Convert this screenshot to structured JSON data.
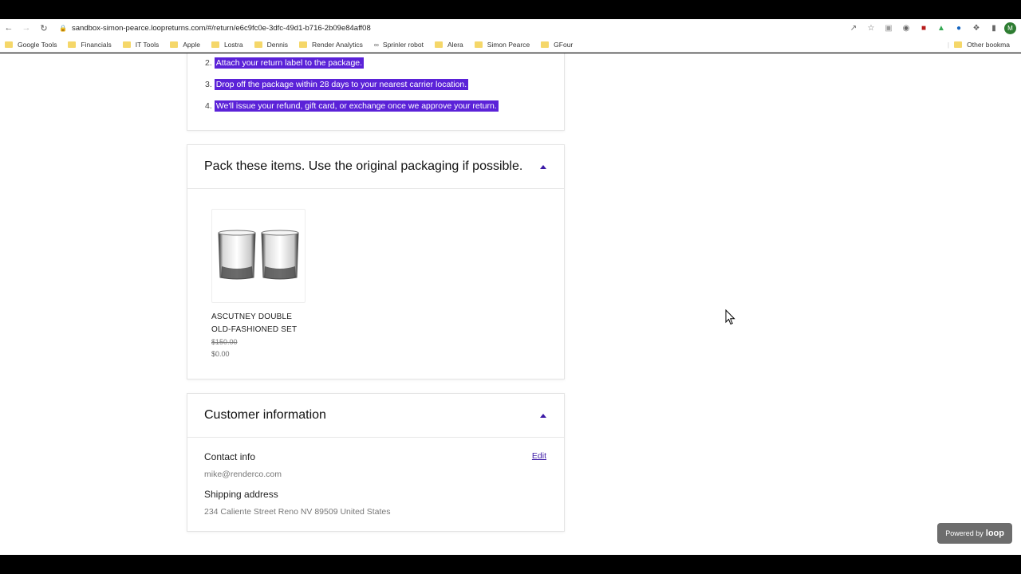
{
  "browser": {
    "url": "sandbox-simon-pearce.loopreturns.com/#/return/e6c9fc0e-3dfc-49d1-b716-2b09e84aff08",
    "avatar_letter": "M",
    "bookmarks": [
      "Google Tools",
      "Financials",
      "IT Tools",
      "Apple",
      "Lostra",
      "Dennis",
      "Render Analytics",
      "Sprinler robot",
      "Alera",
      "Simon Pearce",
      "GFour"
    ],
    "other_bookmarks": "Other bookma"
  },
  "steps": [
    {
      "num": "2.",
      "text": "Attach your return label to the package."
    },
    {
      "num": "3.",
      "text": "Drop off the package within 28 days to your nearest carrier location."
    },
    {
      "num": "4.",
      "text": "We'll issue your refund, gift card, or exchange once we approve your return."
    }
  ],
  "pack": {
    "title": "Pack these items. Use the original packaging if possible.",
    "item": {
      "name_line1": "ASCUTNEY DOUBLE",
      "name_line2": "OLD-FASHIONED SET",
      "original_price": "$150.00",
      "price": "$0.00"
    }
  },
  "customer": {
    "title": "Customer information",
    "contact_label": "Contact info",
    "contact_value": "mike@renderco.com",
    "edit_label": "Edit",
    "shipping_label": "Shipping address",
    "shipping_value": "234 Caliente Street Reno NV 89509 United States"
  },
  "powered": {
    "prefix": "Powered by",
    "brand": "loop"
  },
  "colors": {
    "accent": "#3c1aa6",
    "highlight": "#5b22d8"
  }
}
